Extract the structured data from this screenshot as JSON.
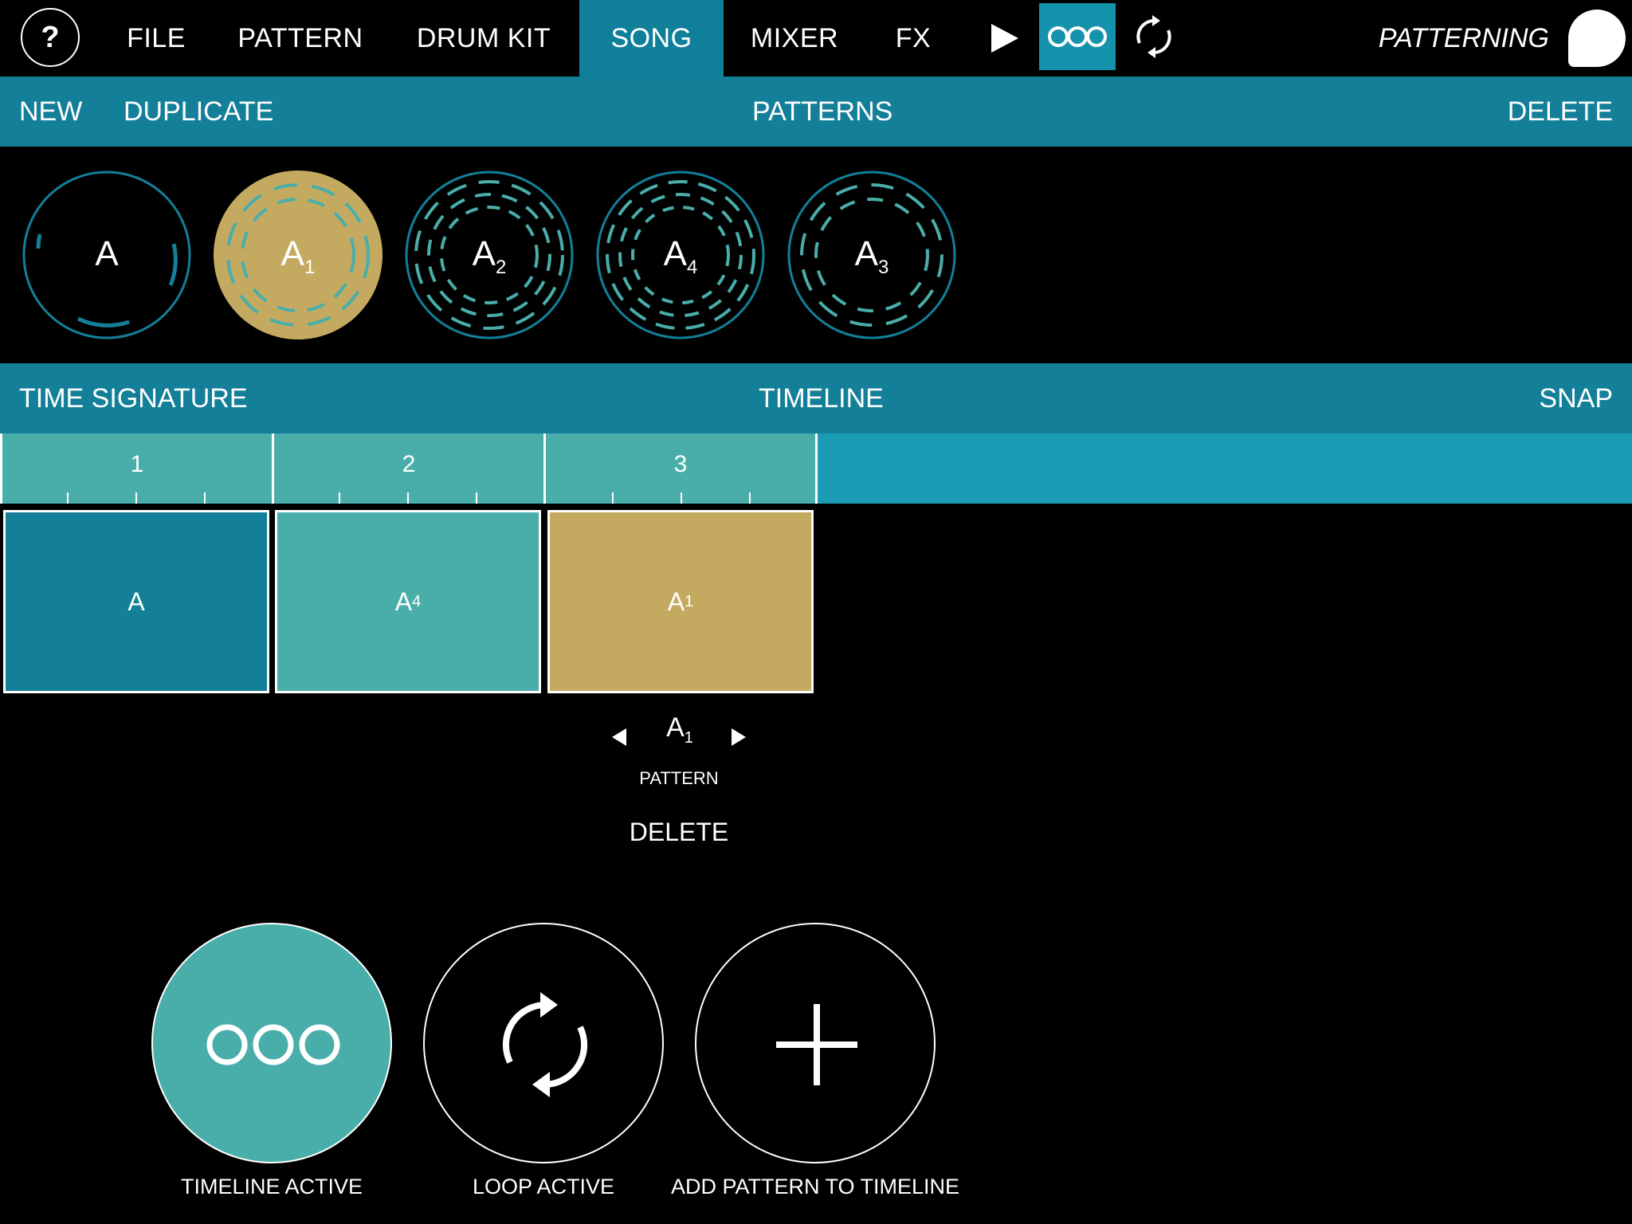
{
  "nav": {
    "help": "?",
    "items": [
      "FILE",
      "PATTERN",
      "DRUM KIT",
      "SONG",
      "MIXER",
      "FX"
    ],
    "active": "SONG",
    "seq_label": "OOO",
    "brand": "PATTERNING"
  },
  "patterns_bar": {
    "new": "NEW",
    "duplicate": "DUPLICATE",
    "title": "PATTERNS",
    "delete": "DELETE"
  },
  "patterns": [
    {
      "base": "A",
      "sub": "",
      "selected": false
    },
    {
      "base": "A",
      "sub": "1",
      "selected": true
    },
    {
      "base": "A",
      "sub": "2",
      "selected": false
    },
    {
      "base": "A",
      "sub": "4",
      "selected": false
    },
    {
      "base": "A",
      "sub": "3",
      "selected": false
    }
  ],
  "timeline_bar": {
    "time_signature": "TIME SIGNATURE",
    "title": "TIMELINE",
    "snap": "SNAP"
  },
  "ruler": [
    "1",
    "2",
    "3"
  ],
  "timeline_blocks": [
    {
      "base": "A",
      "sub": "",
      "color": "#137f99"
    },
    {
      "base": "A",
      "sub": "4",
      "color": "#49aeaa"
    },
    {
      "base": "A",
      "sub": "1",
      "color": "#c4aa60"
    }
  ],
  "selector": {
    "base": "A",
    "sub": "1",
    "label": "PATTERN",
    "delete": "DELETE"
  },
  "actions": {
    "timeline_active": "TIMELINE ACTIVE",
    "timeline_icon": "OOO",
    "loop_active": "LOOP ACTIVE",
    "add_pattern": "ADD PATTERN TO TIMELINE"
  },
  "colors": {
    "bar": "#137f99",
    "teal": "#49aeaa",
    "gold": "#c4aa60",
    "ruler_bg": "#1a9bb4"
  }
}
